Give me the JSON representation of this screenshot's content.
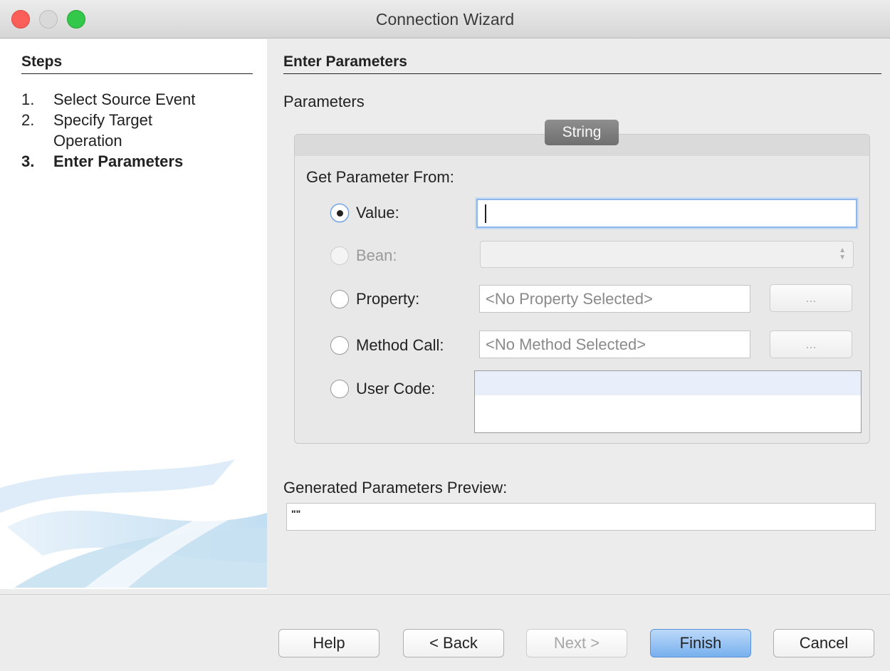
{
  "window": {
    "title": "Connection Wizard"
  },
  "steps": {
    "heading": "Steps",
    "items": [
      {
        "num": "1.",
        "label": "Select Source Event"
      },
      {
        "num": "2.",
        "label": "Specify Target Operation"
      },
      {
        "num": "3.",
        "label": "Enter Parameters"
      }
    ]
  },
  "content": {
    "heading": "Enter Parameters",
    "parameters_label": "Parameters",
    "tab_label": "String",
    "get_from_label": "Get Parameter From:"
  },
  "options": {
    "value": {
      "label": "Value:",
      "input_value": "",
      "selected": true
    },
    "bean": {
      "label": "Bean:",
      "enabled": false
    },
    "property": {
      "label": "Property:",
      "placeholder": "<No Property Selected>",
      "button": "..."
    },
    "method_call": {
      "label": "Method Call:",
      "placeholder": "<No Method Selected>",
      "button": "..."
    },
    "user_code": {
      "label": "User Code:"
    }
  },
  "preview": {
    "label": "Generated Parameters Preview:",
    "value": "\"\""
  },
  "buttons": {
    "help": "Help",
    "back": "< Back",
    "next": "Next >",
    "finish": "Finish",
    "cancel": "Cancel"
  }
}
